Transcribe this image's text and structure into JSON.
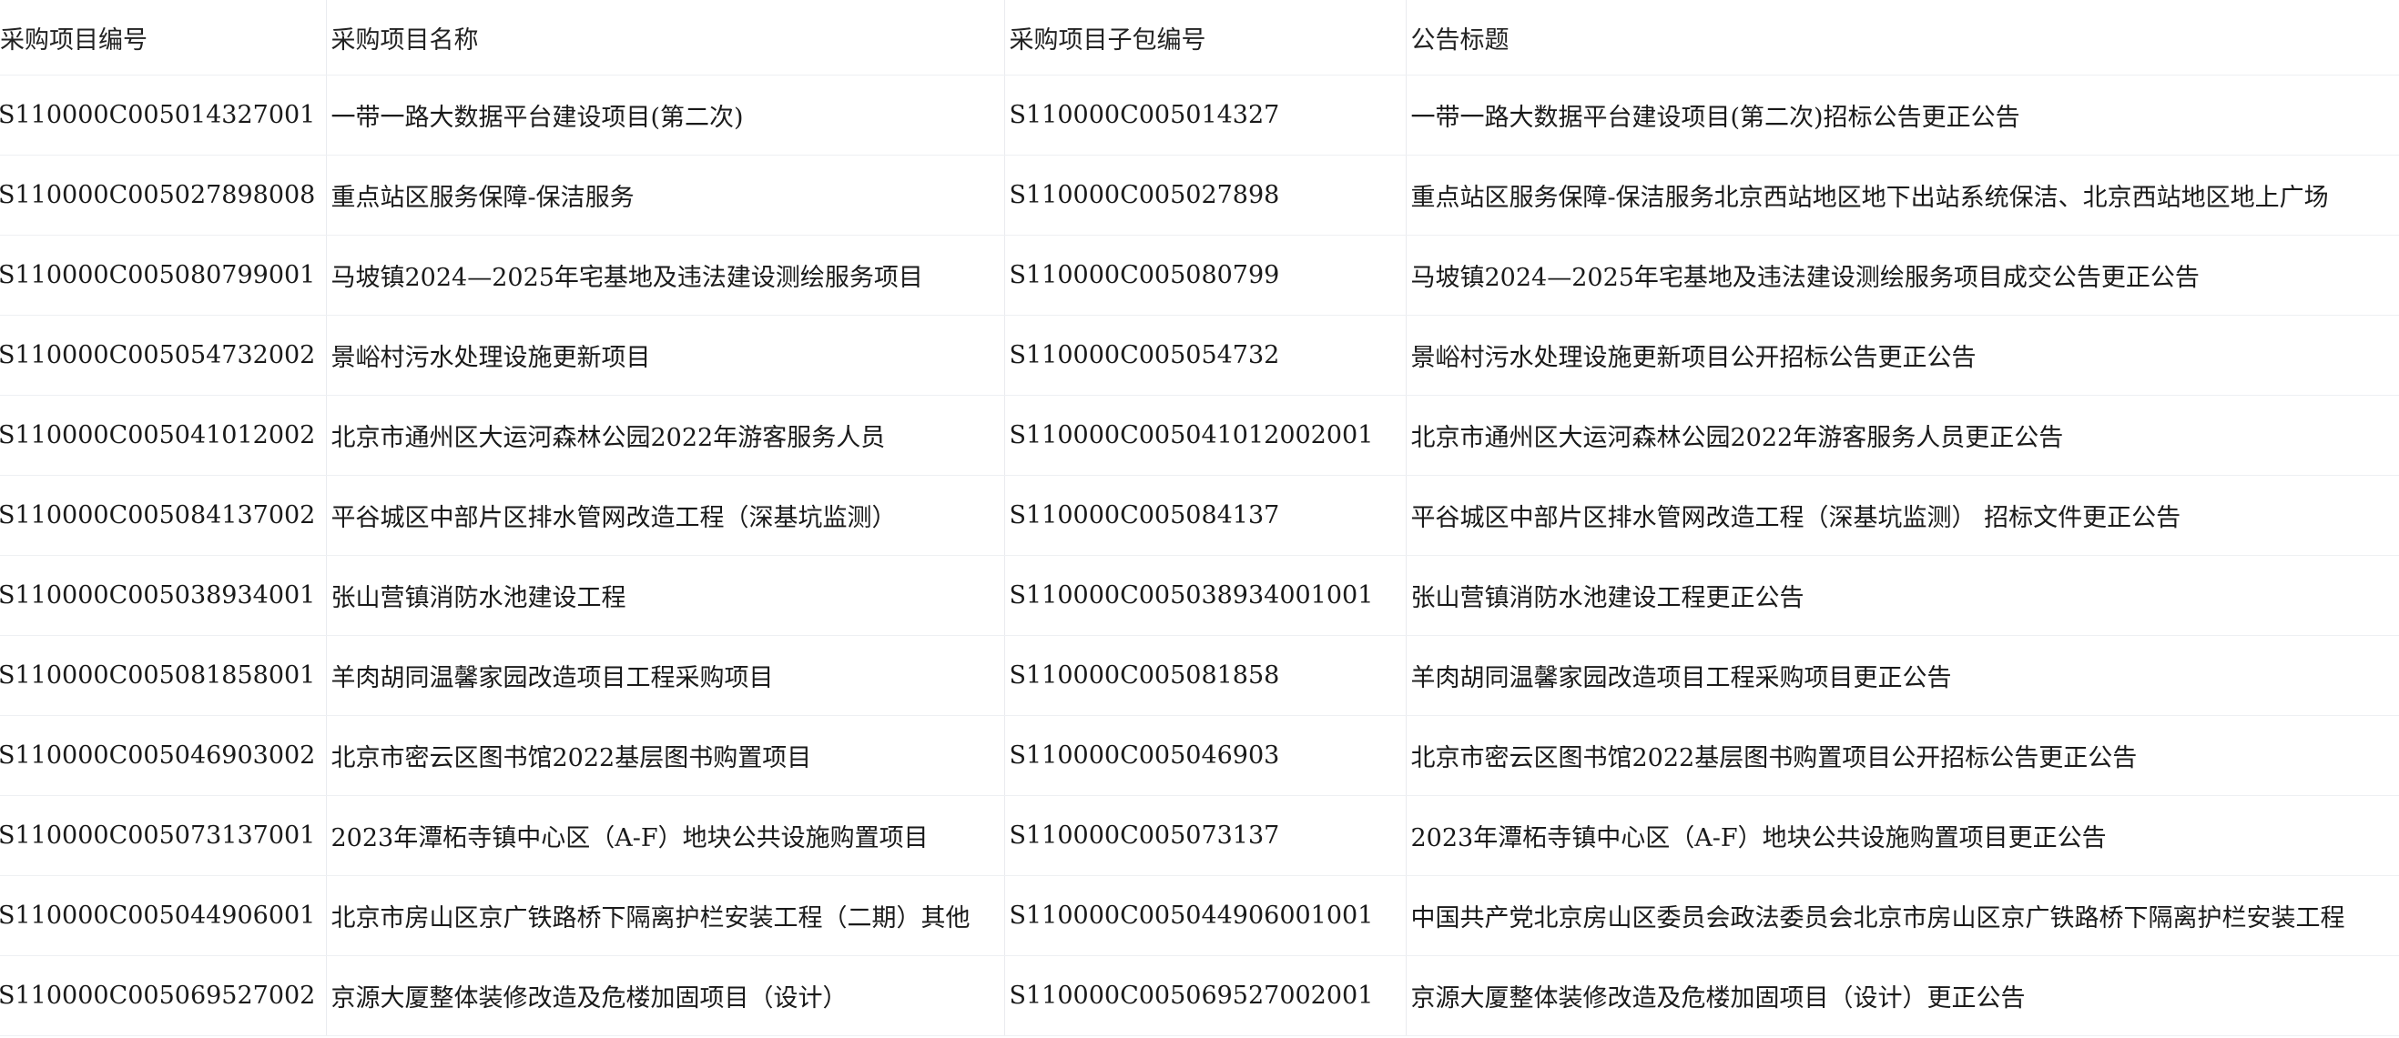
{
  "table": {
    "headers": [
      "采购项目编号",
      "采购项目名称",
      "采购项目子包编号",
      "公告标题"
    ],
    "rows": [
      [
        "S110000C005014327001",
        "一带一路大数据平台建设项目(第二次)",
        "S110000C005014327",
        "一带一路大数据平台建设项目(第二次)招标公告更正公告"
      ],
      [
        "S110000C005027898008",
        "重点站区服务保障-保洁服务",
        "S110000C005027898",
        "重点站区服务保障-保洁服务北京西站地区地下出站系统保洁、北京西站地区地上广场"
      ],
      [
        "S110000C005080799001",
        "马坡镇2024—2025年宅基地及违法建设测绘服务项目",
        "S110000C005080799",
        "马坡镇2024—2025年宅基地及违法建设测绘服务项目成交公告更正公告"
      ],
      [
        "S110000C005054732002",
        "景峪村污水处理设施更新项目",
        "S110000C005054732",
        "景峪村污水处理设施更新项目公开招标公告更正公告"
      ],
      [
        "S110000C005041012002",
        "北京市通州区大运河森林公园2022年游客服务人员",
        "S110000C005041012002001",
        "北京市通州区大运河森林公园2022年游客服务人员更正公告"
      ],
      [
        "S110000C005084137002",
        "平谷城区中部片区排水管网改造工程（深基坑监测）",
        "S110000C005084137",
        "平谷城区中部片区排水管网改造工程（深基坑监测）  招标文件更正公告"
      ],
      [
        "S110000C005038934001",
        "张山营镇消防水池建设工程",
        "S110000C005038934001001",
        "张山营镇消防水池建设工程更正公告"
      ],
      [
        "S110000C005081858001",
        "羊肉胡同温馨家园改造项目工程采购项目",
        "S110000C005081858",
        "羊肉胡同温馨家园改造项目工程采购项目更正公告"
      ],
      [
        "S110000C005046903002",
        "北京市密云区图书馆2022基层图书购置项目",
        "S110000C005046903",
        "北京市密云区图书馆2022基层图书购置项目公开招标公告更正公告"
      ],
      [
        "S110000C005073137001",
        "2023年潭柘寺镇中心区（A-F）地块公共设施购置项目",
        "S110000C005073137",
        "2023年潭柘寺镇中心区（A-F）地块公共设施购置项目更正公告"
      ],
      [
        "S110000C005044906001",
        "北京市房山区京广铁路桥下隔离护栏安装工程（二期）其他",
        "S110000C005044906001001",
        "中国共产党北京房山区委员会政法委员会北京市房山区京广铁路桥下隔离护栏安装工程"
      ],
      [
        "S110000C005069527002",
        "京源大厦整体装修改造及危楼加固项目（设计）",
        "S110000C005069527002001",
        "京源大厦整体装修改造及危楼加固项目（设计）更正公告"
      ]
    ]
  }
}
